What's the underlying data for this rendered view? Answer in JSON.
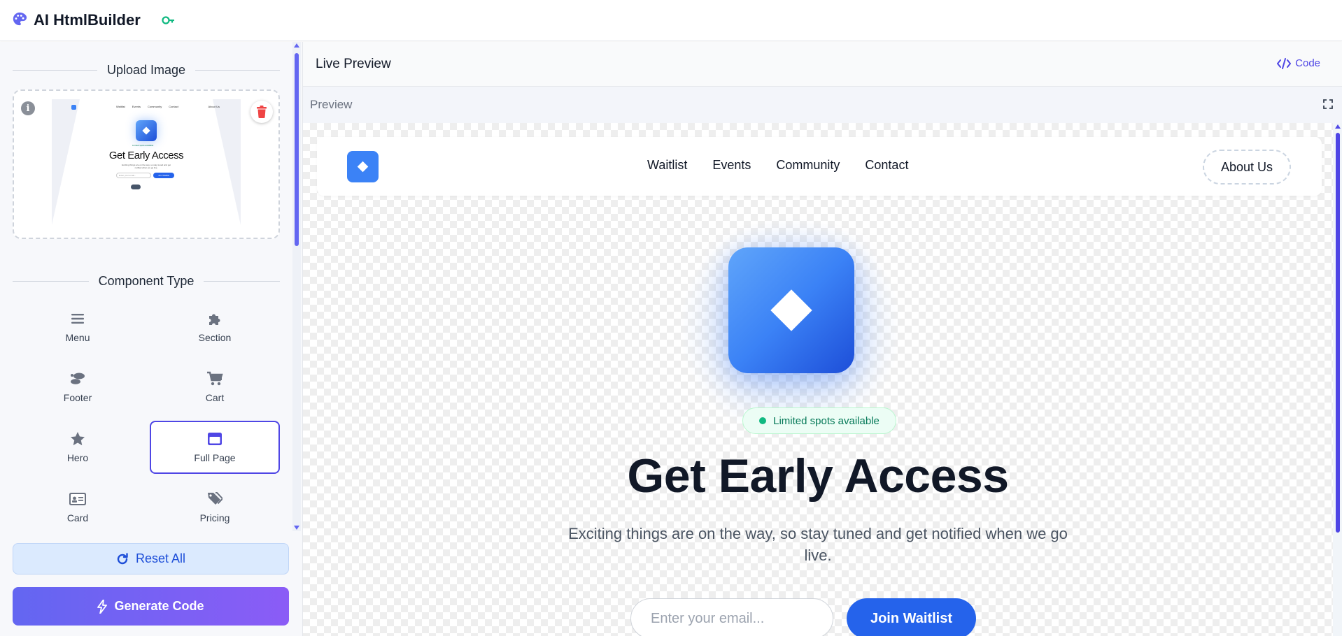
{
  "app": {
    "title": "AI HtmlBuilder",
    "logo_icon": "palette-icon",
    "status_icon": "key-icon"
  },
  "sidebar": {
    "upload_title": "Upload Image",
    "component_title": "Component Type",
    "thumbnail": {
      "nav_items": [
        "Waitlist",
        "Events",
        "Community",
        "Contact"
      ],
      "about": "About Us",
      "badge": "Limited spots available",
      "title": "Get Early Access",
      "subtitle": "Exciting things are on the way, so stay tuned and get notified when we go live.",
      "input_placeholder": "Enter your email...",
      "button": "Join Waitlist"
    },
    "components": [
      {
        "label": "Menu",
        "icon": "menu-icon"
      },
      {
        "label": "Section",
        "icon": "puzzle-icon"
      },
      {
        "label": "Footer",
        "icon": "footprints-icon"
      },
      {
        "label": "Cart",
        "icon": "cart-icon"
      },
      {
        "label": "Hero",
        "icon": "star-icon"
      },
      {
        "label": "Full Page",
        "icon": "window-icon",
        "selected": true
      },
      {
        "label": "Card",
        "icon": "id-card-icon"
      },
      {
        "label": "Pricing",
        "icon": "tags-icon"
      }
    ],
    "reset_label": "Reset All",
    "generate_label": "Generate Code"
  },
  "main": {
    "live_preview_title": "Live Preview",
    "code_label": "Code",
    "preview_label": "Preview"
  },
  "preview_site": {
    "nav_items": [
      "Waitlist",
      "Events",
      "Community",
      "Contact"
    ],
    "about_label": "About Us",
    "badge_text": "Limited spots available",
    "headline": "Get Early Access",
    "subheadline": "Exciting things are on the way, so stay tuned and get notified when we go live.",
    "email_placeholder": "Enter your email...",
    "join_label": "Join Waitlist"
  },
  "colors": {
    "accent": "#4f46e5",
    "primary_blue": "#2563eb",
    "success": "#10b981",
    "danger": "#ef4444"
  }
}
